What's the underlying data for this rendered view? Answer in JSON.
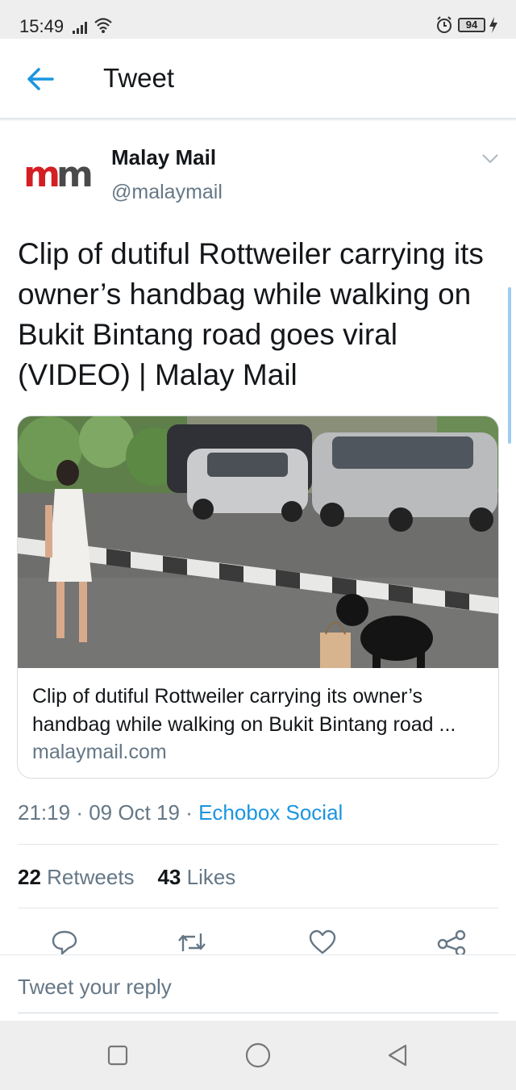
{
  "status_bar": {
    "time": "15:49",
    "battery": "94",
    "icons": [
      "signal-icon",
      "wifi-icon",
      "alarm-icon",
      "battery-icon",
      "charging-icon"
    ]
  },
  "header": {
    "title": "Tweet",
    "back_icon": "arrow-left-icon"
  },
  "tweet": {
    "author_name": "Malay Mail",
    "author_handle": "@malaymail",
    "avatar_text": "mm",
    "text": "Clip of dutiful Rottweiler carrying its owner’s handbag while walking on Bukit Bintang road goes viral (VIDEO) | Malay Mail",
    "card": {
      "title": "Clip of dutiful Rottweiler carrying its owner’s handbag while walking on Bukit Bintang road ...",
      "domain": "malaymail.com"
    },
    "time": "21:19",
    "date": "09 Oct 19",
    "separator": "·",
    "source": "Echobox Social",
    "retweets_count": "22",
    "retweets_label": "Retweets",
    "likes_count": "43",
    "likes_label": "Likes"
  },
  "actions": [
    "reply-icon",
    "retweet-icon",
    "like-icon",
    "share-icon"
  ],
  "reply": {
    "placeholder": "Tweet your reply"
  },
  "nav": [
    "recents-icon",
    "home-icon",
    "back-icon"
  ],
  "colors": {
    "accent": "#1b95e0",
    "text": "#14171a",
    "secondary": "#657786",
    "brand_red": "#d41d24"
  }
}
